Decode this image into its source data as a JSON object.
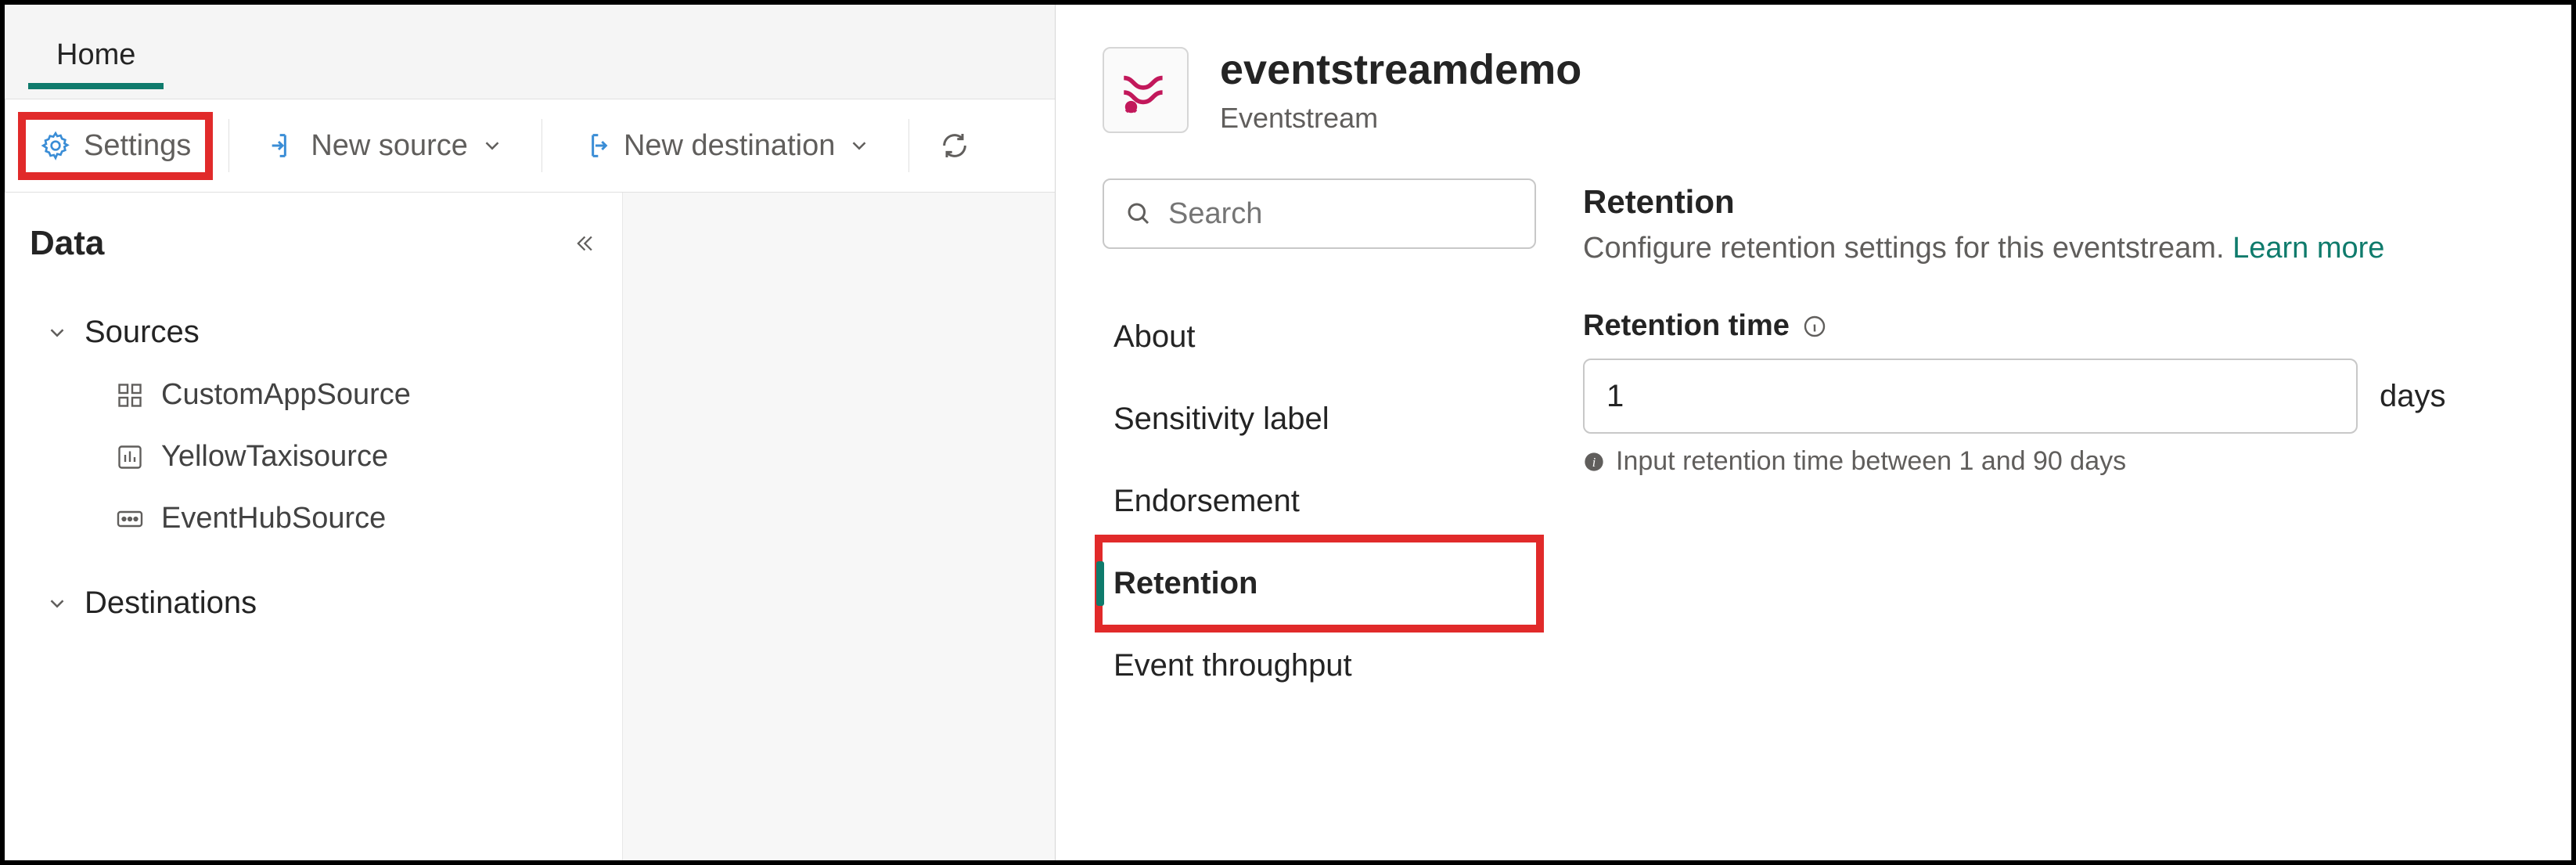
{
  "tabs": {
    "home": "Home"
  },
  "toolbar": {
    "settings": "Settings",
    "new_source": "New source",
    "new_destination": "New destination"
  },
  "data_panel": {
    "title": "Data",
    "sections": {
      "sources": "Sources",
      "destinations": "Destinations"
    },
    "sources": [
      {
        "label": "CustomAppSource"
      },
      {
        "label": "YellowTaxisource"
      },
      {
        "label": "EventHubSource"
      }
    ]
  },
  "pane": {
    "title": "eventstreamdemo",
    "subtitle": "Eventstream",
    "search_placeholder": "Search",
    "nav": {
      "about": "About",
      "sensitivity": "Sensitivity label",
      "endorsement": "Endorsement",
      "retention": "Retention",
      "throughput": "Event throughput"
    },
    "retention": {
      "heading": "Retention",
      "description": "Configure retention settings for this eventstream. ",
      "learn_more": "Learn more",
      "field_label": "Retention time",
      "value": "1",
      "unit": "days",
      "hint": "Input retention time between 1 and 90 days"
    }
  }
}
